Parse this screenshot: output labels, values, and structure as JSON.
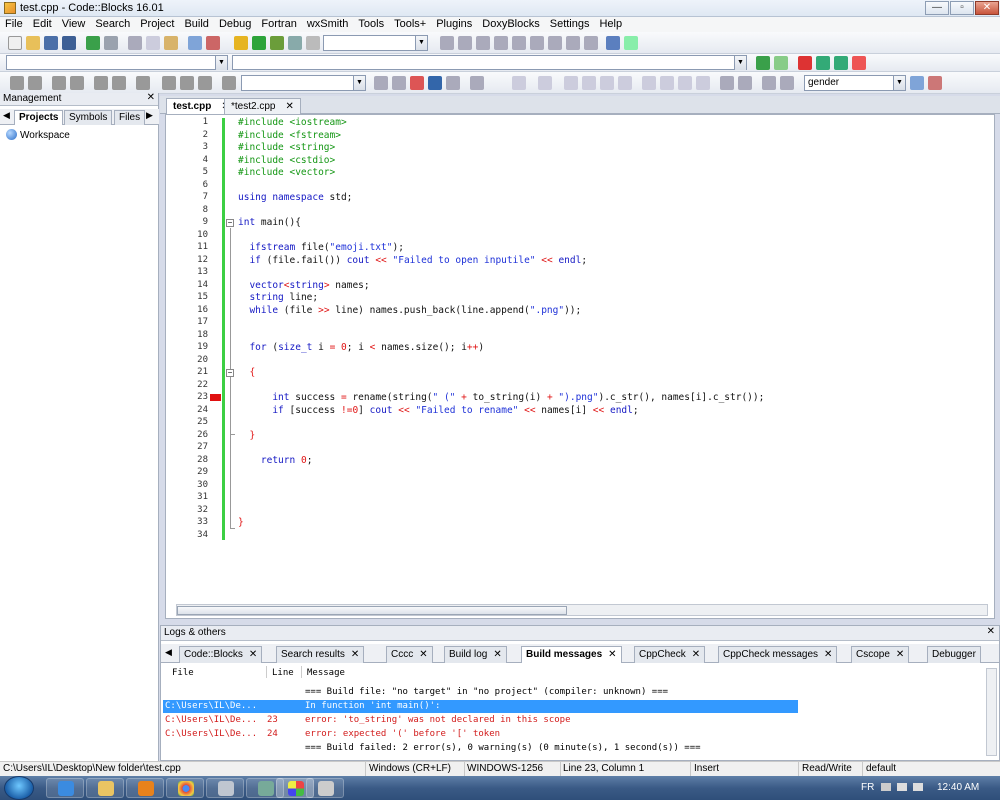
{
  "window": {
    "title": "test.cpp - Code::Blocks 16.01"
  },
  "menu": [
    "File",
    "Edit",
    "View",
    "Search",
    "Project",
    "Build",
    "Debug",
    "Fortran",
    "wxSmith",
    "Tools",
    "Tools+",
    "Plugins",
    "DoxyBlocks",
    "Settings",
    "Help"
  ],
  "toolbar": {
    "search_combo_value": "gender"
  },
  "management": {
    "title": "Management",
    "tabs": [
      "Projects",
      "Symbols",
      "Files"
    ],
    "workspace_label": "Workspace"
  },
  "editor": {
    "tabs": [
      {
        "label": "test.cpp"
      },
      {
        "label": "*test2.cpp"
      }
    ],
    "lines": [
      [
        [
          "pp",
          "#include <iostream>"
        ]
      ],
      [
        [
          "pp",
          "#include <fstream>"
        ]
      ],
      [
        [
          "pp",
          "#include <string>"
        ]
      ],
      [
        [
          "pp",
          "#include <cstdio>"
        ]
      ],
      [
        [
          "pp",
          "#include <vector>"
        ]
      ],
      [],
      [
        [
          "kw",
          "using namespace"
        ],
        [
          "plain",
          " std;"
        ]
      ],
      [],
      [
        [
          "kw",
          "int"
        ],
        [
          "plain",
          " main(){"
        ]
      ],
      [],
      [
        [
          "plain",
          "  "
        ],
        [
          "kw",
          "ifstream"
        ],
        [
          "plain",
          " file("
        ],
        [
          "str",
          "\"emoji.txt\""
        ],
        [
          "plain",
          ");"
        ]
      ],
      [
        [
          "plain",
          "  "
        ],
        [
          "kw",
          "if"
        ],
        [
          "plain",
          " (file.fail()) "
        ],
        [
          "kw",
          "cout"
        ],
        [
          "plain",
          " "
        ],
        [
          "op",
          "<<"
        ],
        [
          "plain",
          " "
        ],
        [
          "str",
          "\"Failed to open inputile\""
        ],
        [
          "plain",
          " "
        ],
        [
          "op",
          "<<"
        ],
        [
          "plain",
          " "
        ],
        [
          "kw",
          "endl"
        ],
        [
          "plain",
          ";"
        ]
      ],
      [],
      [
        [
          "plain",
          "  "
        ],
        [
          "kw",
          "vector"
        ],
        [
          "op",
          "<"
        ],
        [
          "kw",
          "string"
        ],
        [
          "op",
          ">"
        ],
        [
          "plain",
          " names;"
        ]
      ],
      [
        [
          "plain",
          "  "
        ],
        [
          "kw",
          "string"
        ],
        [
          "plain",
          " line;"
        ]
      ],
      [
        [
          "plain",
          "  "
        ],
        [
          "kw",
          "while"
        ],
        [
          "plain",
          " (file "
        ],
        [
          "op",
          ">>"
        ],
        [
          "plain",
          " line) names.push_back(line.append("
        ],
        [
          "str",
          "\".png\""
        ],
        [
          "plain",
          "));"
        ]
      ],
      [],
      [],
      [
        [
          "plain",
          "  "
        ],
        [
          "kw",
          "for"
        ],
        [
          "plain",
          " ("
        ],
        [
          "kw",
          "size_t"
        ],
        [
          "plain",
          " i "
        ],
        [
          "op",
          "="
        ],
        [
          "plain",
          " "
        ],
        [
          "num",
          "0"
        ],
        [
          "plain",
          "; i "
        ],
        [
          "op",
          "<"
        ],
        [
          "plain",
          " names.size(); i"
        ],
        [
          "op",
          "++"
        ],
        [
          "plain",
          ")"
        ]
      ],
      [],
      [
        [
          "plain",
          "  "
        ],
        [
          "op",
          "{"
        ]
      ],
      [],
      [
        [
          "plain",
          "      "
        ],
        [
          "kw",
          "int"
        ],
        [
          "plain",
          " success "
        ],
        [
          "op",
          "="
        ],
        [
          "plain",
          " rename(string("
        ],
        [
          "str",
          "\" (\""
        ],
        [
          "plain",
          " "
        ],
        [
          "op",
          "+"
        ],
        [
          "plain",
          " to_string(i) "
        ],
        [
          "op",
          "+"
        ],
        [
          "plain",
          " "
        ],
        [
          "str",
          "\").png\""
        ],
        [
          "plain",
          ").c_str(), names[i].c_str());"
        ]
      ],
      [
        [
          "plain",
          "      "
        ],
        [
          "kw",
          "if"
        ],
        [
          "plain",
          " [success "
        ],
        [
          "op",
          "!="
        ],
        [
          "num",
          "0"
        ],
        [
          "plain",
          "] "
        ],
        [
          "kw",
          "cout"
        ],
        [
          "plain",
          " "
        ],
        [
          "op",
          "<<"
        ],
        [
          "plain",
          " "
        ],
        [
          "str",
          "\"Failed to rename\""
        ],
        [
          "plain",
          " "
        ],
        [
          "op",
          "<<"
        ],
        [
          "plain",
          " names[i] "
        ],
        [
          "op",
          "<<"
        ],
        [
          "plain",
          " "
        ],
        [
          "kw",
          "endl"
        ],
        [
          "plain",
          ";"
        ]
      ],
      [],
      [
        [
          "plain",
          "  "
        ],
        [
          "op",
          "}"
        ]
      ],
      [],
      [
        [
          "plain",
          "    "
        ],
        [
          "kw",
          "return"
        ],
        [
          "plain",
          " "
        ],
        [
          "num",
          "0"
        ],
        [
          "plain",
          ";"
        ]
      ],
      [],
      [],
      [],
      [],
      [
        [
          "op",
          "}"
        ]
      ],
      []
    ]
  },
  "logs": {
    "title": "Logs & others",
    "tabs": [
      "Code::Blocks",
      "Search results",
      "Cccc",
      "Build log",
      "Build messages",
      "CppCheck",
      "CppCheck messages",
      "Cscope",
      "Debugger"
    ],
    "columns": {
      "file": "File",
      "line": "Line",
      "message": "Message"
    },
    "rows": [
      {
        "file": "",
        "line": "",
        "message": "=== Build file: \"no target\" in \"no project\" (compiler: unknown) ===",
        "type": "info"
      },
      {
        "file": "C:\\Users\\IL\\De...",
        "line": "",
        "message": "In function 'int main()':",
        "type": "sel"
      },
      {
        "file": "C:\\Users\\IL\\De...",
        "line": "23",
        "message": "error: 'to_string' was not declared in this scope",
        "type": "err"
      },
      {
        "file": "C:\\Users\\IL\\De...",
        "line": "24",
        "message": "error: expected '(' before '[' token",
        "type": "err"
      },
      {
        "file": "",
        "line": "",
        "message": "=== Build failed: 2 error(s), 0 warning(s) (0 minute(s), 1 second(s)) ===",
        "type": "info"
      }
    ]
  },
  "status": {
    "path": "C:\\Users\\IL\\Desktop\\New folder\\test.cpp",
    "eol": "Windows (CR+LF)",
    "encoding": "WINDOWS-1256",
    "position": "Line 23, Column 1",
    "mode": "Insert",
    "access": "Read/Write",
    "theme": "default"
  },
  "tray": {
    "lang": "FR",
    "time": "12:40 AM"
  }
}
